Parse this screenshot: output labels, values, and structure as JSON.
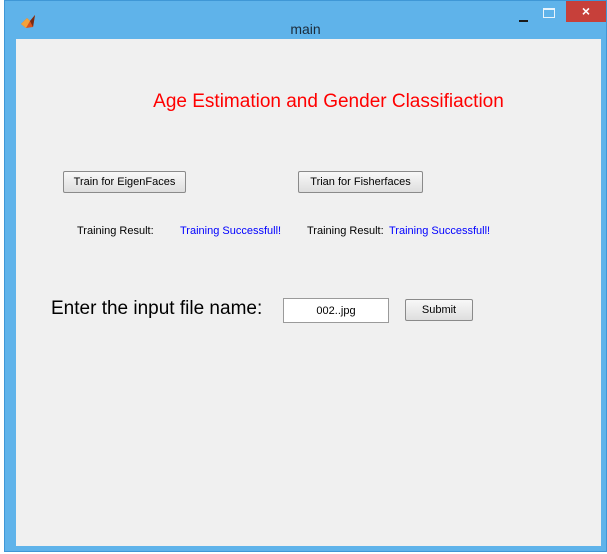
{
  "window": {
    "title": "main",
    "close_glyph": "×",
    "icons": [
      "matlab-icon",
      "minimize-icon",
      "maximize-icon",
      "close-icon"
    ]
  },
  "main": {
    "heading": "Age Estimation and Gender Classifiaction",
    "buttons": {
      "eigen": "Train for EigenFaces",
      "fisher": "Trian for Fisherfaces",
      "submit": "Submit"
    },
    "training": {
      "label1": "Training Result:",
      "value1": "Training Successfull!",
      "label2": "Training Result:",
      "value2": "Training Successfull!"
    },
    "input": {
      "label": "Enter the input file name:",
      "value": "002..jpg"
    }
  },
  "colors": {
    "titlebar": "#5fb3ea",
    "close_button": "#c7403a",
    "heading": "#ff0000",
    "result_value": "#0000ff",
    "client_bg": "#f0f0f0"
  }
}
